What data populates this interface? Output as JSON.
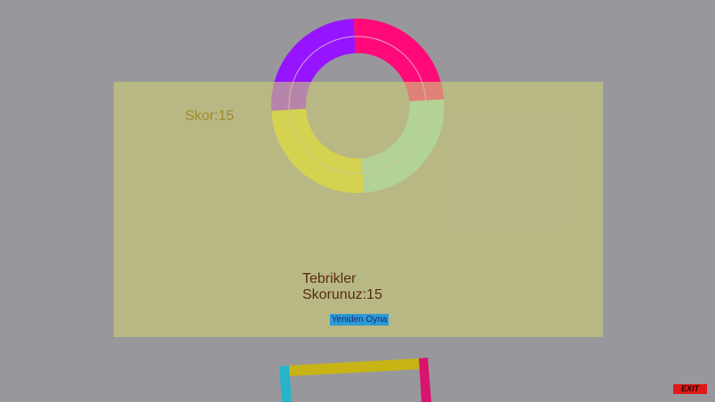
{
  "hud": {
    "score_label": "Skor:15"
  },
  "game_over": {
    "message": "Tebrikler",
    "final_score": "Skorunuz:15",
    "replay_button": "Yeniden Oyna"
  },
  "exit_button": "EXIT",
  "colors": {
    "background": "#98989c",
    "ring_magenta": "#ff0a78",
    "ring_purple": "#9614ff",
    "ring_yellow": "#e8dc14",
    "ring_teal": "#8cdcc8",
    "bar_yellow": "#c8b414",
    "bar_magenta": "#d8146e",
    "bar_cyan": "#28b4c8",
    "panel": "#ccc978"
  },
  "game_state": {
    "score": 15,
    "status": "game over"
  }
}
